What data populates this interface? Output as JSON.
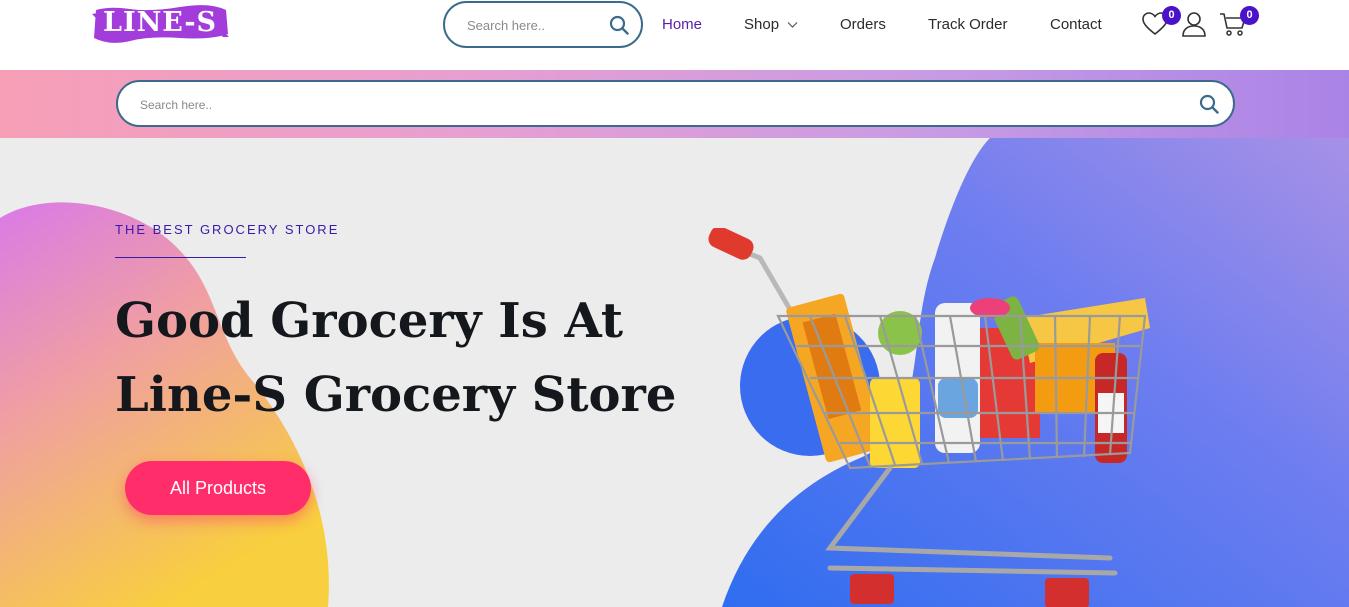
{
  "brand": {
    "logo_text": "LINE-S",
    "logo_color": "#a23cdb"
  },
  "header": {
    "search": {
      "placeholder": "Search here.."
    },
    "nav": [
      {
        "label": "Home",
        "active": true
      },
      {
        "label": "Shop",
        "has_dropdown": true
      },
      {
        "label": "Orders"
      },
      {
        "label": "Track Order"
      },
      {
        "label": "Contact"
      }
    ],
    "wishlist": {
      "icon": "heart-icon",
      "count": "0"
    },
    "account": {
      "icon": "user-icon"
    },
    "cart": {
      "icon": "cart-icon",
      "count": "0"
    }
  },
  "search_band": {
    "placeholder": "Search here.."
  },
  "hero": {
    "eyebrow": "THE BEST GROCERY STORE",
    "headline_line1": "Good Grocery Is At",
    "headline_line2": "Line-S Grocery Store",
    "cta_label": "All Products",
    "cta_color": "#ff2e6b",
    "image_subject": "shopping-cart-with-groceries"
  },
  "colors": {
    "accent": "#5a1fa8",
    "badge": "#4a12c9",
    "search_border": "#3b6b8c",
    "blue_blob": "#4f6cf0",
    "pink_blob": "#e07ad6",
    "yellow_blob": "#f8c94a"
  }
}
